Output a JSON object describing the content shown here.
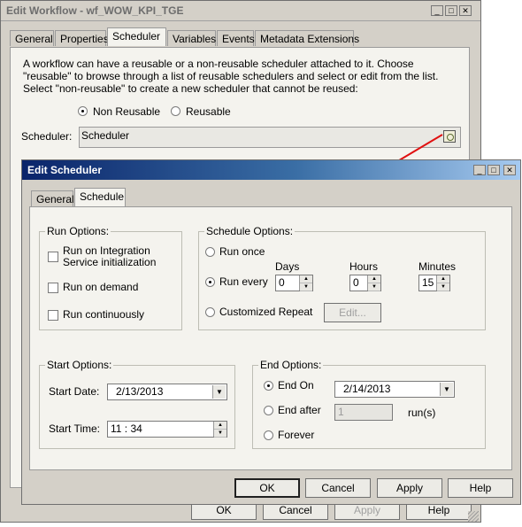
{
  "outer": {
    "title": "Edit Workflow - wf_WOW_KPI_TGE",
    "tabs": [
      "General",
      "Properties",
      "Scheduler",
      "Variables",
      "Events",
      "Metadata Extensions"
    ],
    "active_tab": "Scheduler",
    "description": "A workflow can have a reusable or a non-reusable scheduler attached to it.  Choose \"reusable\" to browse through a list of reusable schedulers and select or edit from the list.  Select \"non-reusable\" to create a new scheduler that cannot be reused:",
    "radio_non_reusable": "Non Reusable",
    "radio_reusable": "Reusable",
    "scheduler_label": "Scheduler:",
    "scheduler_value": "Scheduler",
    "buttons": {
      "ok": "OK",
      "cancel": "Cancel",
      "apply": "Apply",
      "help": "Help"
    }
  },
  "dialog": {
    "title": "Edit Scheduler",
    "tabs": [
      "General",
      "Schedule"
    ],
    "active_tab": "Schedule",
    "run_options": {
      "legend": "Run Options:",
      "integration": "Run on Integration Service initialization",
      "on_demand": "Run on demand",
      "continuously": "Run continuously"
    },
    "schedule_options": {
      "legend": "Schedule Options:",
      "run_once": "Run once",
      "run_every": "Run every",
      "customized": "Customized Repeat",
      "days_label": "Days",
      "hours_label": "Hours",
      "minutes_label": "Minutes",
      "days": "0",
      "hours": "0",
      "minutes": "15",
      "edit_button": "Edit..."
    },
    "start_options": {
      "legend": "Start Options:",
      "date_label": "Start Date:",
      "date_value": "2/13/2013",
      "time_label": "Start Time:",
      "time_value": "11 : 34"
    },
    "end_options": {
      "legend": "End Options:",
      "end_on": "End On",
      "end_on_value": "2/14/2013",
      "end_after": "End after",
      "end_after_value": "1",
      "runs_unit": "run(s)",
      "forever": "Forever"
    },
    "buttons": {
      "ok": "OK",
      "cancel": "Cancel",
      "apply": "Apply",
      "help": "Help"
    }
  },
  "colors": {
    "title_active": "#0a246a",
    "title_gradient_end": "#a6caf0",
    "arrow": "#e01010"
  }
}
